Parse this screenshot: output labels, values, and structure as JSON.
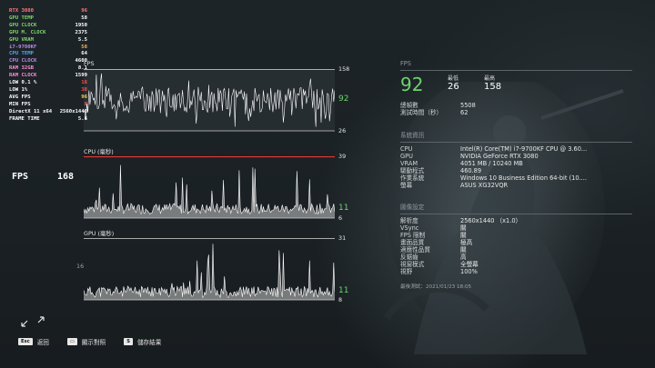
{
  "osd": [
    {
      "label": "RTX 3080",
      "value": "96",
      "lc": "#ff7a7a",
      "vc": "#ff7a7a"
    },
    {
      "label": "GPU TEMP",
      "value": "58",
      "lc": "#7fd86b",
      "vc": "#ffffff"
    },
    {
      "label": "GPU CLOCK",
      "value": "1950",
      "lc": "#7fd86b",
      "vc": "#ffffff"
    },
    {
      "label": "GPU M. CLOCK",
      "value": "2375",
      "lc": "#7fd86b",
      "vc": "#ffffff"
    },
    {
      "label": "GPU VRAM",
      "value": "5.5",
      "lc": "#7fd86b",
      "vc": "#ffffff"
    },
    {
      "label": "i7-9700KF",
      "value": "58",
      "lc": "#b98be8",
      "vc": "#ffb347"
    },
    {
      "label": "CPU TEMP",
      "value": "64",
      "lc": "#4fa8ff",
      "vc": "#ffffff"
    },
    {
      "label": "CPU CLOCK",
      "value": "4600",
      "lc": "#b98be8",
      "vc": "#ffffff"
    },
    {
      "label": "RAM 32GB",
      "value": "8.1",
      "lc": "#ff8ad8",
      "vc": "#ffffff"
    },
    {
      "label": "RAM CLOCK",
      "value": "1599",
      "lc": "#ff8ad8",
      "vc": "#ffffff"
    },
    {
      "label": "LOW 0.1 %",
      "value": "16",
      "lc": "#ffffff",
      "vc": "#ff4a4a"
    },
    {
      "label": "LOW 1%",
      "value": "38",
      "lc": "#ffffff",
      "vc": "#ff4a4a"
    },
    {
      "label": "AVG FPS",
      "value": "96",
      "lc": "#ffffff",
      "vc": "#ffd54a"
    },
    {
      "label": "MIN FPS",
      "value": "8",
      "lc": "#ffffff",
      "vc": "#ff4a4a"
    },
    {
      "label": "DirectX 11 x64",
      "value": "2560x1440",
      "lc": "#ffffff",
      "vc": "#ffffff"
    },
    {
      "label": "FRAME TIME",
      "value": "5.6",
      "lc": "#ffffff",
      "vc": "#ffffff"
    }
  ],
  "fps_overlay": {
    "label": "FPS",
    "value": "168"
  },
  "graphs": [
    {
      "title": "FPS",
      "max": "158",
      "min": "26",
      "current": "92",
      "lo": 26,
      "hi": 158,
      "base": 92,
      "amp": 40,
      "seed": 3,
      "line": "#ffffff"
    },
    {
      "title": "CPU (毫秒)",
      "max": "39",
      "min": "6",
      "current": "11",
      "lo": 6,
      "hi": 39,
      "base": 11,
      "amp": 4,
      "seed": 7,
      "line": "#ffffff"
    },
    {
      "title": "GPU (毫秒)",
      "max": "31",
      "min": "8",
      "current": "11",
      "lo": 8,
      "hi": 31,
      "base": 11,
      "amp": 3,
      "seed": 11,
      "line": "#ffffff"
    }
  ],
  "graph_side_label": "16",
  "panel": {
    "fps_header": "FPS",
    "fps_current": "92",
    "min_label": "最低",
    "min_value": "26",
    "max_label": "最高",
    "max_value": "158",
    "total_frames_label": "總幀數",
    "total_frames_value": "5508",
    "test_time_label": "測試時間（秒）",
    "test_time_value": "62",
    "system_header": "系統資訊",
    "system": [
      {
        "k": "CPU",
        "v": "Intel(R) Core(TM) i7-9700KF CPU @ 3.60..."
      },
      {
        "k": "GPU",
        "v": "NVIDIA GeForce RTX 3080"
      },
      {
        "k": "VRAM",
        "v": "4051 MB / 10240 MB"
      },
      {
        "k": "驅動程式",
        "v": "460.89"
      },
      {
        "k": "作業系統",
        "v": "Windows 10 Business Edition 64-bit (10...."
      },
      {
        "k": "螢幕",
        "v": "ASUS XG32VQR"
      }
    ],
    "settings_header": "圖像設定",
    "settings": [
      {
        "k": "解析度",
        "v": "2560x1440 （x1.0）"
      },
      {
        "k": "VSync",
        "v": "關"
      },
      {
        "k": "FPS 限制",
        "v": "關"
      },
      {
        "k": "畫面品質",
        "v": "極高"
      },
      {
        "k": "適應性品質",
        "v": "關"
      },
      {
        "k": "反鋸齒",
        "v": "高"
      },
      {
        "k": "視窗模式",
        "v": "全螢幕"
      },
      {
        "k": "視野",
        "v": "100%"
      }
    ],
    "last_test": "最後測試：2021/01/23 18:05"
  },
  "bottom": [
    {
      "key": "Esc",
      "label": "返回"
    },
    {
      "key": "▭",
      "label": "顯示對照"
    },
    {
      "key": "S",
      "label": "儲存結果"
    }
  ],
  "colors": {
    "accent_green": "#6bd46b",
    "cpu_red": "#e53935"
  }
}
